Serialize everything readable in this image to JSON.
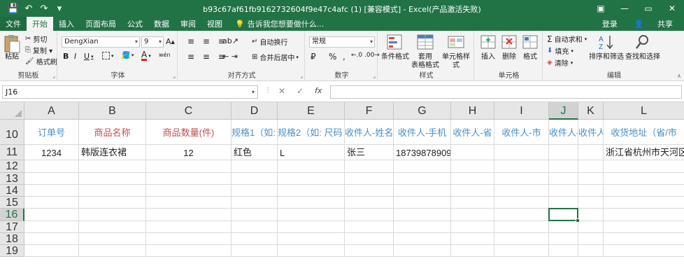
{
  "window": {
    "title": "b93c67af61fb9162732604f9e47c4afc (1)  [兼容模式] - Excel(产品激活失败)",
    "minimize": "—",
    "restore": "▭",
    "close": "✕"
  },
  "quick_access": {
    "save": "💾",
    "undo": "↶",
    "redo": "↷",
    "customize": "▾"
  },
  "tabs": [
    "文件",
    "开始",
    "插入",
    "页面布局",
    "公式",
    "数据",
    "审阅",
    "视图"
  ],
  "active_tab": "开始",
  "tell_me": "告诉我您想要做什么...",
  "account": {
    "login": "登录",
    "share": "共享"
  },
  "ribbon": {
    "clipboard": {
      "label": "剪贴板",
      "paste": "粘贴",
      "cut": "剪切",
      "copy": "复制 ▾",
      "format_painter": "格式刷"
    },
    "font": {
      "label": "字体",
      "font_name": "DengXian",
      "font_size": "9",
      "bold": "B",
      "italic": "I",
      "underline": "U",
      "grow": "A",
      "shrink": "A",
      "font_color": "A",
      "wen": "wén"
    },
    "alignment": {
      "label": "对齐方式",
      "wrap": "自动换行",
      "merge": "合并后居中"
    },
    "number": {
      "label": "数字",
      "format": "常规",
      "currency": "₽",
      "percent": "%",
      "comma": ","
    },
    "styles": {
      "label": "样式",
      "conditional": "条件格式",
      "table": "套用\n表格格式",
      "cell_styles": "单元格样式"
    },
    "cells": {
      "label": "单元格",
      "insert": "插入",
      "delete": "删除",
      "format": "格式"
    },
    "editing": {
      "label": "编辑",
      "autosum": "自动求和",
      "fill": "填充",
      "clear": "清除",
      "sort": "排序和筛选",
      "find": "查找和选择"
    }
  },
  "name_box": "J16",
  "formula_bar": {
    "cancel": "✕",
    "enter": "✓",
    "fx": "fx",
    "value": ""
  },
  "columns": [
    "A",
    "B",
    "C",
    "D",
    "E",
    "F",
    "G",
    "H",
    "I",
    "J",
    "K",
    "L"
  ],
  "selected_column": "J",
  "rows": [
    "10",
    "11",
    "12",
    "13",
    "14",
    "15",
    "16",
    "17",
    "18",
    "19"
  ],
  "selected_row": "16",
  "header_row": [
    "订单号",
    "商品名称",
    "商品数量(件)",
    "规格1（如:",
    "规格2（如: 尺码",
    "收件人-姓名",
    "收件人-手机",
    "收件人-省",
    "收件人-市",
    "收件人-区",
    "收件人-详细",
    "收货地址（省/市"
  ],
  "data_row": [
    "1234",
    "韩版连衣裙",
    "12",
    "红色",
    "L",
    "张三",
    "18739878909",
    "",
    "",
    "",
    "",
    "浙江省杭州市天河区"
  ]
}
